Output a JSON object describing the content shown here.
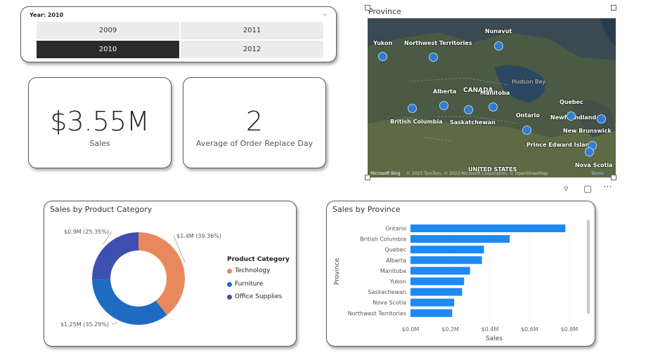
{
  "slicer": {
    "header": "Year: 2010",
    "years": [
      {
        "label": "2009",
        "selected": false
      },
      {
        "label": "2011",
        "selected": false
      },
      {
        "label": "2010",
        "selected": true
      },
      {
        "label": "2012",
        "selected": false
      }
    ]
  },
  "kpi_sales": {
    "value": "$3.55M",
    "label": "Sales"
  },
  "kpi_replace": {
    "value": "2",
    "label": "Average of Order Replace Day"
  },
  "map": {
    "title": "Province",
    "labels": [
      "Nunavut",
      "Yukon",
      "Northwest Territories",
      "Hudson Bay",
      "Alberta",
      "CANADA",
      "Manitoba",
      "Quebec",
      "Newfoundland",
      "British Columbia",
      "Saskatchewan",
      "Ontario",
      "New Brunswick",
      "Prince Edward Island",
      "Nova Scotia",
      "UNITED STATES"
    ],
    "attribution": "© 2023 TomTom, © 2023 Microsoft Corporation, © OpenStreetMap",
    "terms": "Terms",
    "brand": "Microsoft Bing"
  },
  "donut": {
    "title": "Sales by Product Category",
    "legend_title": "Product Category",
    "colors": {
      "Technology": "#e8895d",
      "Furniture": "#1f6bc2",
      "Office Supplies": "#3f4fb0"
    }
  },
  "bars": {
    "title": "Sales by Province",
    "color": "#1e88f5"
  },
  "chart_data": [
    {
      "type": "pie",
      "title": "Sales by Product Category",
      "legend_title": "Product Category",
      "categories": [
        "Technology",
        "Furniture",
        "Office Supplies"
      ],
      "values": [
        1.4,
        1.25,
        0.9
      ],
      "labels": [
        "$1.4M (39.36%)",
        "$1.25M (35.29%)",
        "$0.9M (25.35%)"
      ],
      "percent": [
        39.36,
        35.29,
        25.35
      ],
      "donut": true
    },
    {
      "type": "bar",
      "orientation": "horizontal",
      "title": "Sales by Province",
      "categories": [
        "Ontario",
        "British Columbia",
        "Quebec",
        "Alberta",
        "Manitoba",
        "Yukon",
        "Saskachewan",
        "Nova Scotia",
        "Northwest Territories"
      ],
      "values": [
        0.78,
        0.5,
        0.37,
        0.36,
        0.3,
        0.27,
        0.26,
        0.22,
        0.21
      ],
      "xlabel": "Sales",
      "ylabel": "Province",
      "xlim": [
        0,
        0.85
      ],
      "xticks": [
        "$0.0M",
        "$0.2M",
        "$0.4M",
        "$0.6M",
        "$0.8M"
      ],
      "grid": true
    }
  ]
}
